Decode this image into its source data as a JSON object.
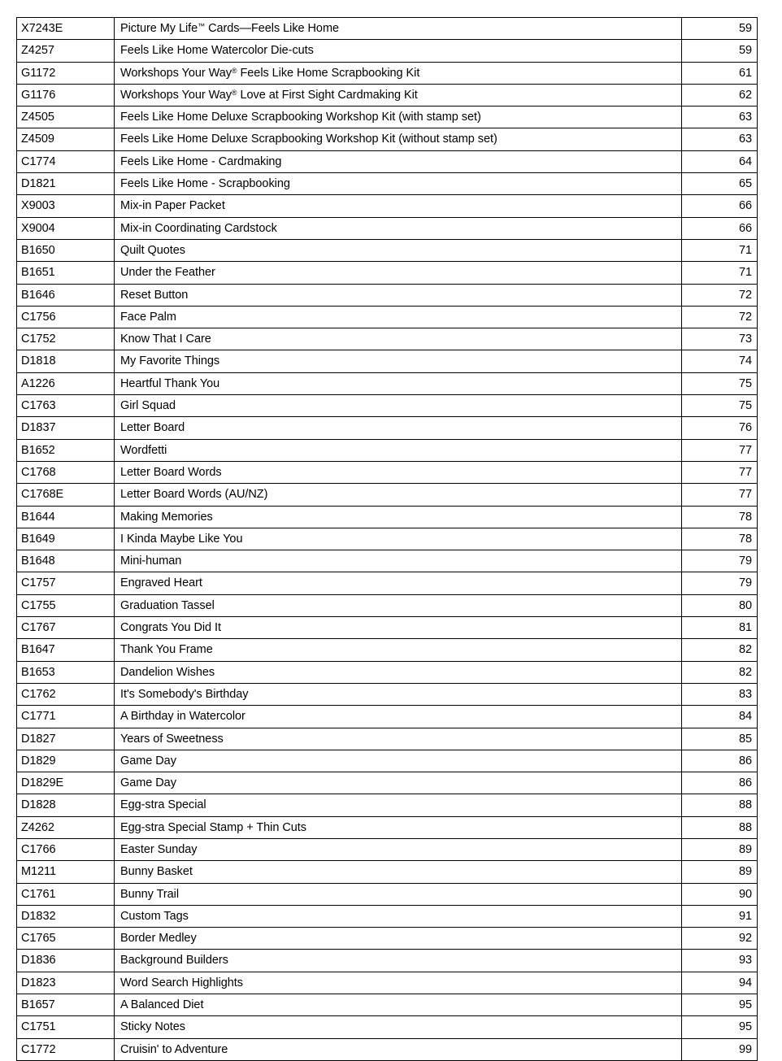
{
  "table": {
    "columns": [
      "sku",
      "product_name",
      "page"
    ],
    "rows": [
      {
        "sku": "X7243E",
        "name": "Picture My Life™ Cards—Feels Like Home",
        "page": "59"
      },
      {
        "sku": "Z4257",
        "name": "Feels Like Home Watercolor Die-cuts",
        "page": "59"
      },
      {
        "sku": "G1172",
        "name": "Workshops Your Way® Feels Like Home Scrapbooking Kit",
        "page": "61"
      },
      {
        "sku": "G1176",
        "name": "Workshops Your Way® Love at First Sight Cardmaking Kit",
        "page": "62"
      },
      {
        "sku": "Z4505",
        "name": "Feels Like Home Deluxe Scrapbooking Workshop Kit (with stamp set)",
        "page": "63"
      },
      {
        "sku": "Z4509",
        "name": "Feels Like Home Deluxe Scrapbooking Workshop Kit (without stamp set)",
        "page": "63"
      },
      {
        "sku": "C1774",
        "name": "Feels Like Home - Cardmaking",
        "page": "64"
      },
      {
        "sku": "D1821",
        "name": "Feels Like Home - Scrapbooking",
        "page": "65"
      },
      {
        "sku": "X9003",
        "name": "Mix-in Paper Packet",
        "page": "66"
      },
      {
        "sku": "X9004",
        "name": "Mix-in Coordinating Cardstock",
        "page": "66"
      },
      {
        "sku": "B1650",
        "name": "Quilt Quotes",
        "page": "71"
      },
      {
        "sku": "B1651",
        "name": "Under the Feather",
        "page": "71"
      },
      {
        "sku": "B1646",
        "name": "Reset Button",
        "page": "72"
      },
      {
        "sku": "C1756",
        "name": "Face Palm",
        "page": "72"
      },
      {
        "sku": "C1752",
        "name": "Know That I Care",
        "page": "73"
      },
      {
        "sku": "D1818",
        "name": "My Favorite Things",
        "page": "74"
      },
      {
        "sku": "A1226",
        "name": "Heartful Thank You",
        "page": "75"
      },
      {
        "sku": "C1763",
        "name": "Girl Squad",
        "page": "75"
      },
      {
        "sku": "D1837",
        "name": "Letter Board",
        "page": "76"
      },
      {
        "sku": "B1652",
        "name": "Wordfetti",
        "page": "77"
      },
      {
        "sku": "C1768",
        "name": "Letter Board Words",
        "page": "77"
      },
      {
        "sku": "C1768E",
        "name": "Letter Board Words (AU/NZ)",
        "page": "77"
      },
      {
        "sku": "B1644",
        "name": "Making Memories",
        "page": "78"
      },
      {
        "sku": "B1649",
        "name": "I Kinda Maybe Like You",
        "page": "78"
      },
      {
        "sku": "B1648",
        "name": "Mini-human",
        "page": "79"
      },
      {
        "sku": "C1757",
        "name": "Engraved Heart",
        "page": "79"
      },
      {
        "sku": "C1755",
        "name": "Graduation Tassel",
        "page": "80"
      },
      {
        "sku": "C1767",
        "name": "Congrats You Did It",
        "page": "81"
      },
      {
        "sku": "B1647",
        "name": "Thank You Frame",
        "page": "82"
      },
      {
        "sku": "B1653",
        "name": "Dandelion Wishes",
        "page": "82"
      },
      {
        "sku": "C1762",
        "name": "It's Somebody's Birthday",
        "page": "83"
      },
      {
        "sku": "C1771",
        "name": "A Birthday in Watercolor",
        "page": "84"
      },
      {
        "sku": "D1827",
        "name": "Years of Sweetness",
        "page": "85"
      },
      {
        "sku": "D1829",
        "name": "Game Day",
        "page": "86"
      },
      {
        "sku": "D1829E",
        "name": "Game Day",
        "page": "86"
      },
      {
        "sku": "D1828",
        "name": "Egg-stra Special",
        "page": "88"
      },
      {
        "sku": "Z4262",
        "name": "Egg-stra Special Stamp + Thin Cuts",
        "page": "88"
      },
      {
        "sku": "C1766",
        "name": "Easter Sunday",
        "page": "89"
      },
      {
        "sku": "M1211",
        "name": "Bunny Basket",
        "page": "89"
      },
      {
        "sku": "C1761",
        "name": "Bunny Trail",
        "page": "90"
      },
      {
        "sku": "D1832",
        "name": "Custom Tags",
        "page": "91"
      },
      {
        "sku": "C1765",
        "name": "Border Medley",
        "page": "92"
      },
      {
        "sku": "D1836",
        "name": "Background Builders",
        "page": "93"
      },
      {
        "sku": "D1823",
        "name": "Word Search Highlights",
        "page": "94"
      },
      {
        "sku": "B1657",
        "name": "A Balanced Diet",
        "page": "95"
      },
      {
        "sku": "C1751",
        "name": "Sticky Notes",
        "page": "95"
      },
      {
        "sku": "C1772",
        "name": "Cruisin' to Adventure",
        "page": "99"
      }
    ]
  },
  "colors": {
    "border": "#000000",
    "text": "#000000",
    "background": "#ffffff"
  }
}
